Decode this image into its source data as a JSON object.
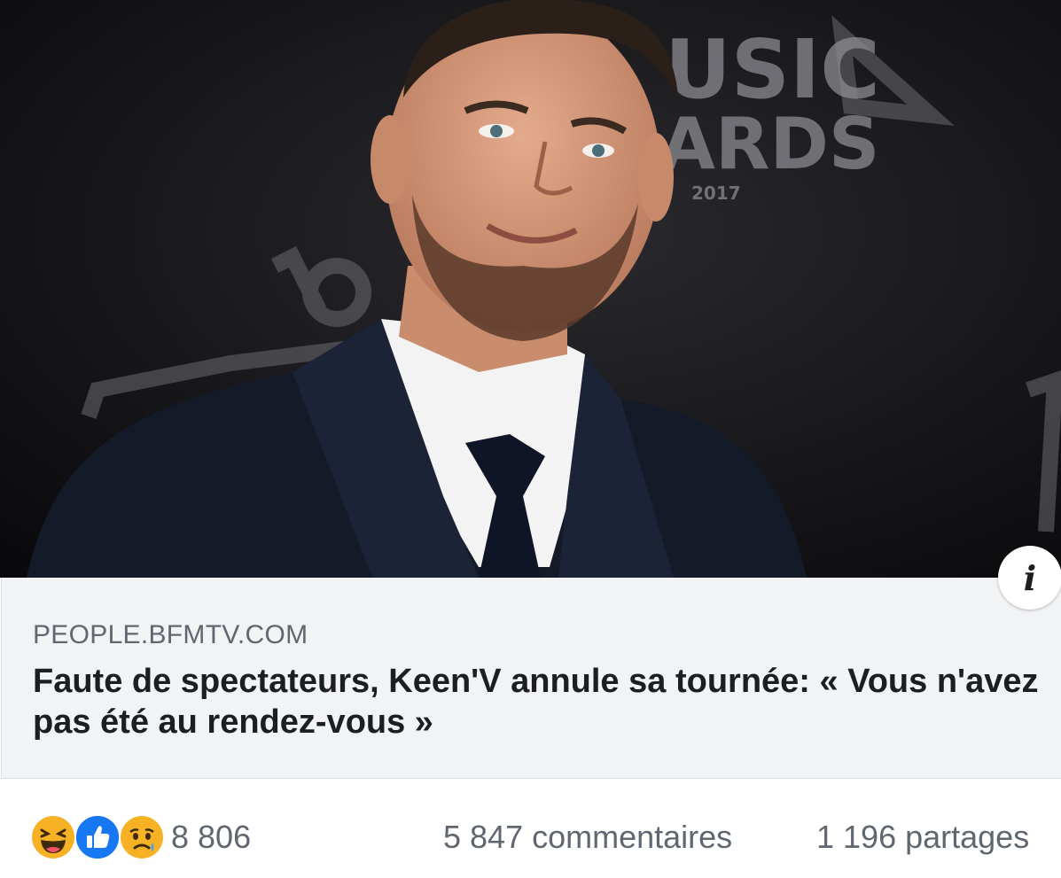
{
  "post": {
    "image_alt": "Keen'V at NRJ Music Awards 2017",
    "backdrop_text": [
      "USIC",
      "ARDS",
      "2017"
    ]
  },
  "link": {
    "domain": "PEOPLE.BFMTV.COM",
    "headline": "Faute de spectateurs, Keen'V annule sa tournée: « Vous n'avez pas été au rendez-vous »",
    "info_icon": "i"
  },
  "engagement": {
    "reaction_icons": [
      "haha-icon",
      "like-icon",
      "sad-icon"
    ],
    "reaction_count": "8 806",
    "comments": "5 847 commentaires",
    "shares": "1 196 partages"
  },
  "colors": {
    "like_blue": "#1877f2",
    "emoji_yellow": "#f7b125",
    "link_bg": "#f2f3f5",
    "muted_text": "#606770"
  }
}
